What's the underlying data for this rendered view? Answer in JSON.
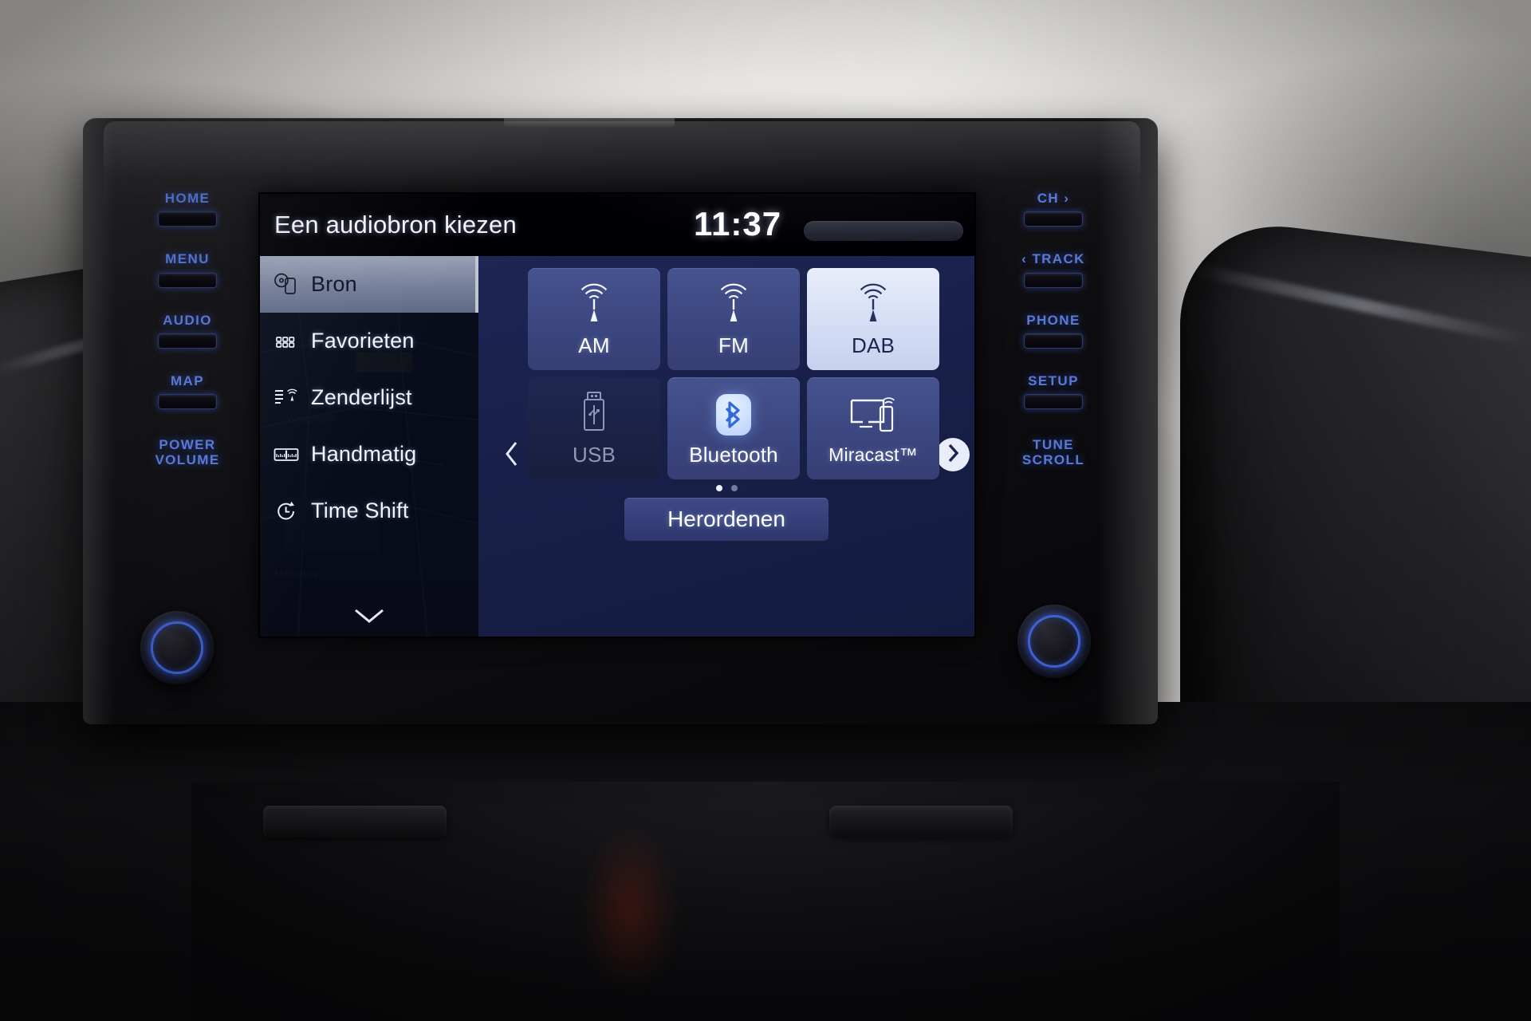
{
  "device": {
    "left_keys": [
      {
        "label": "HOME",
        "name": "home-hardkey",
        "button": true
      },
      {
        "label": "MENU",
        "name": "menu-hardkey",
        "button": true
      },
      {
        "label": "AUDIO",
        "name": "audio-hardkey",
        "button": true
      },
      {
        "label": "MAP",
        "name": "map-hardkey",
        "button": true
      },
      {
        "label": "POWER\nVOLUME",
        "name": "power-volume-knob-label",
        "button": false
      }
    ],
    "right_keys": [
      {
        "label": "CH ›",
        "name": "channel-up-hardkey",
        "button": true
      },
      {
        "label": "‹ TRACK",
        "name": "track-back-hardkey",
        "button": true
      },
      {
        "label": "PHONE",
        "name": "phone-hardkey",
        "button": true
      },
      {
        "label": "SETUP",
        "name": "setup-hardkey",
        "button": true
      },
      {
        "label": "TUNE\nSCROLL",
        "name": "tune-scroll-knob-label",
        "button": false
      }
    ],
    "accent_color": "#5a7ad8"
  },
  "header": {
    "title": "Een audiobron kiezen",
    "clock": "11:37"
  },
  "sidebar": {
    "items": [
      {
        "label": "Bron",
        "icon": "disc-phone-icon",
        "selected": true
      },
      {
        "label": "Favorieten",
        "icon": "grid-dots-icon",
        "selected": false
      },
      {
        "label": "Zenderlijst",
        "icon": "list-antenna-icon",
        "selected": false
      },
      {
        "label": "Handmatig",
        "icon": "tuner-scale-icon",
        "selected": false
      },
      {
        "label": "Time Shift",
        "icon": "clock-icon",
        "selected": false
      }
    ],
    "expand_icon": "chevron-down-icon"
  },
  "main": {
    "prev_icon": "chevron-left-icon",
    "next_icon": "chevron-right-icon",
    "tiles": [
      {
        "label": "AM",
        "icon": "antenna-waves-icon",
        "state": "normal"
      },
      {
        "label": "FM",
        "icon": "antenna-waves-icon",
        "state": "normal"
      },
      {
        "label": "DAB",
        "icon": "antenna-waves-icon",
        "state": "selected"
      },
      {
        "label": "USB",
        "icon": "usb-stick-icon",
        "state": "disabled"
      },
      {
        "label": "Bluetooth",
        "icon": "bluetooth-icon",
        "state": "normal"
      },
      {
        "label": "Miracast™",
        "icon": "screen-cast-icon",
        "state": "normal"
      }
    ],
    "pages": {
      "count": 2,
      "current": 1
    },
    "reorder_label": "Herordenen"
  },
  "colors": {
    "tile_normal": "#3c4780",
    "tile_selected": "#d6dff5",
    "tile_disabled": "#1b2245",
    "pane_bg": "#182049",
    "bluetooth_blue": "#2f6ae0",
    "key_glow": "#5a7ad8"
  }
}
